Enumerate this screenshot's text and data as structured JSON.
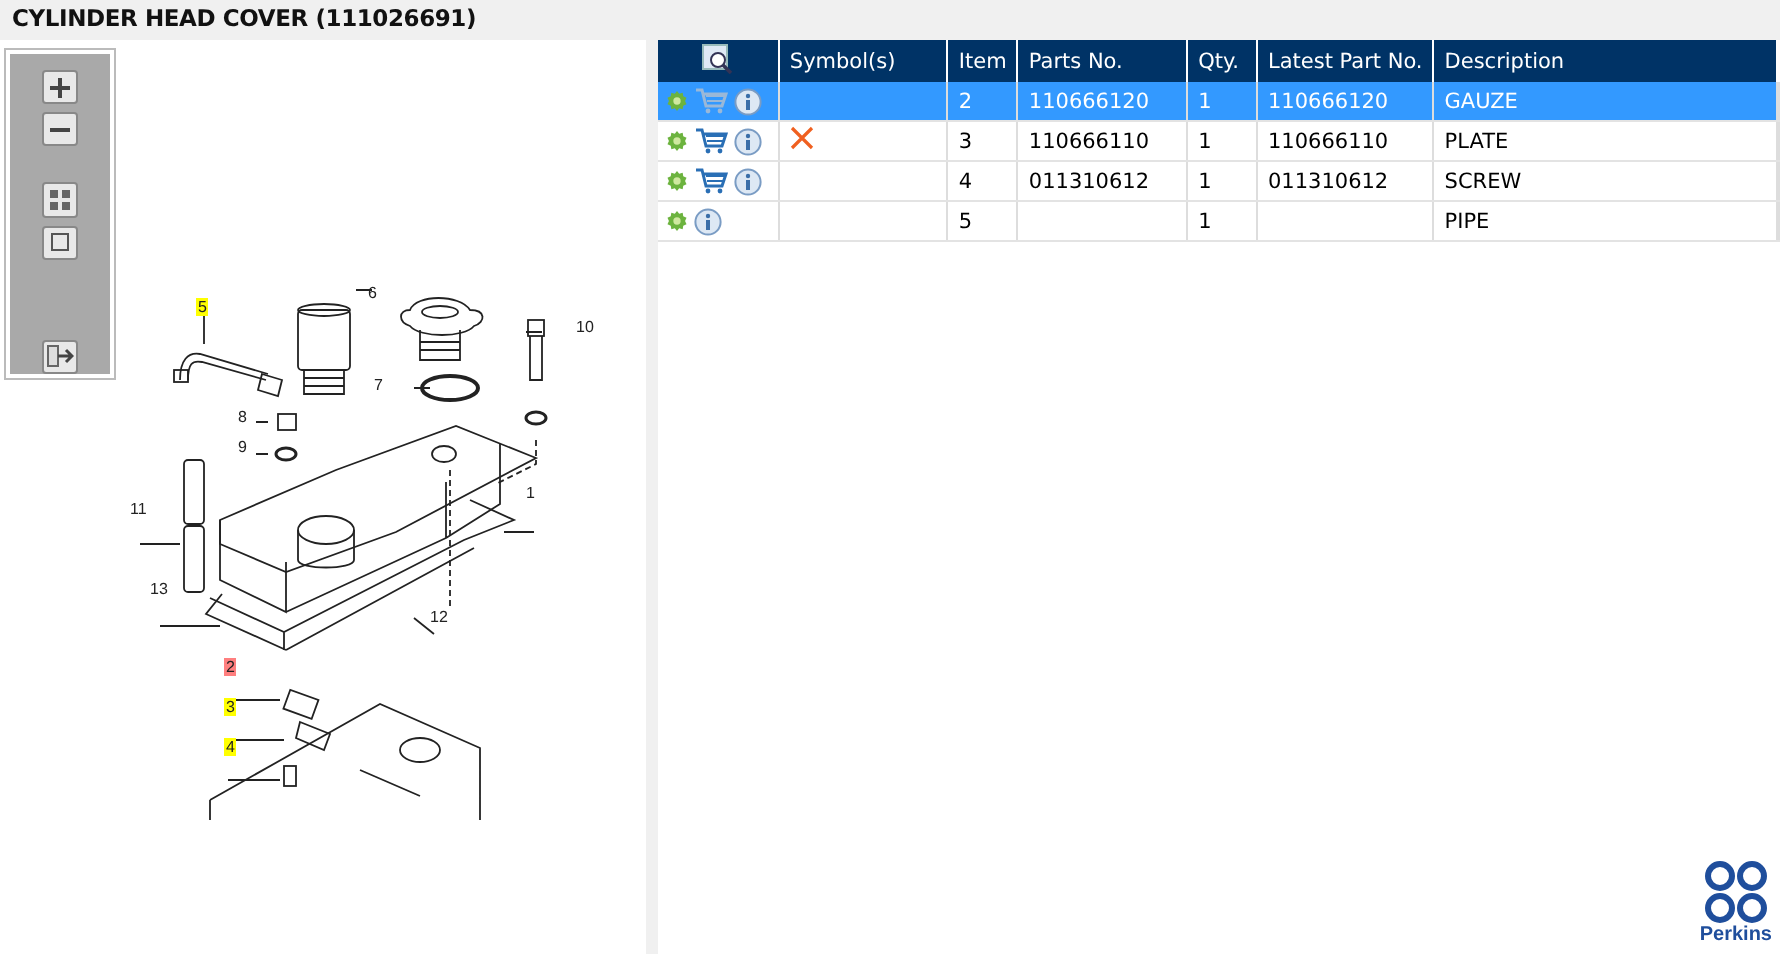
{
  "title": "CYLINDER HEAD COVER (111026691)",
  "diagram": {
    "callouts": [
      {
        "label": "5",
        "color": "#ffff00"
      },
      {
        "label": "6"
      },
      {
        "label": "10"
      },
      {
        "label": "7"
      },
      {
        "label": "8"
      },
      {
        "label": "9"
      },
      {
        "label": "11"
      },
      {
        "label": "1"
      },
      {
        "label": "13"
      },
      {
        "label": "12"
      },
      {
        "label": "2",
        "color": "#ff7f7f"
      },
      {
        "label": "3",
        "color": "#ffff00"
      },
      {
        "label": "4",
        "color": "#ffff00"
      }
    ]
  },
  "table": {
    "columns": [
      "Symbol(s)",
      "Item",
      "Parts No.",
      "Qty.",
      "Latest Part No.",
      "Description"
    ],
    "rows": [
      {
        "selected": true,
        "cart": true,
        "cross": false,
        "item": "2",
        "parts_no": "110666120",
        "qty": "1",
        "latest": "110666120",
        "description": "GAUZE"
      },
      {
        "selected": false,
        "cart": true,
        "cross": true,
        "item": "3",
        "parts_no": "110666110",
        "qty": "1",
        "latest": "110666110",
        "description": "PLATE"
      },
      {
        "selected": false,
        "cart": true,
        "cross": false,
        "item": "4",
        "parts_no": "011310612",
        "qty": "1",
        "latest": "011310612",
        "description": "SCREW"
      },
      {
        "selected": false,
        "cart": false,
        "cross": false,
        "item": "5",
        "parts_no": "",
        "qty": "1",
        "latest": "",
        "description": "PIPE"
      }
    ]
  },
  "logo": {
    "text": "Perkins"
  }
}
